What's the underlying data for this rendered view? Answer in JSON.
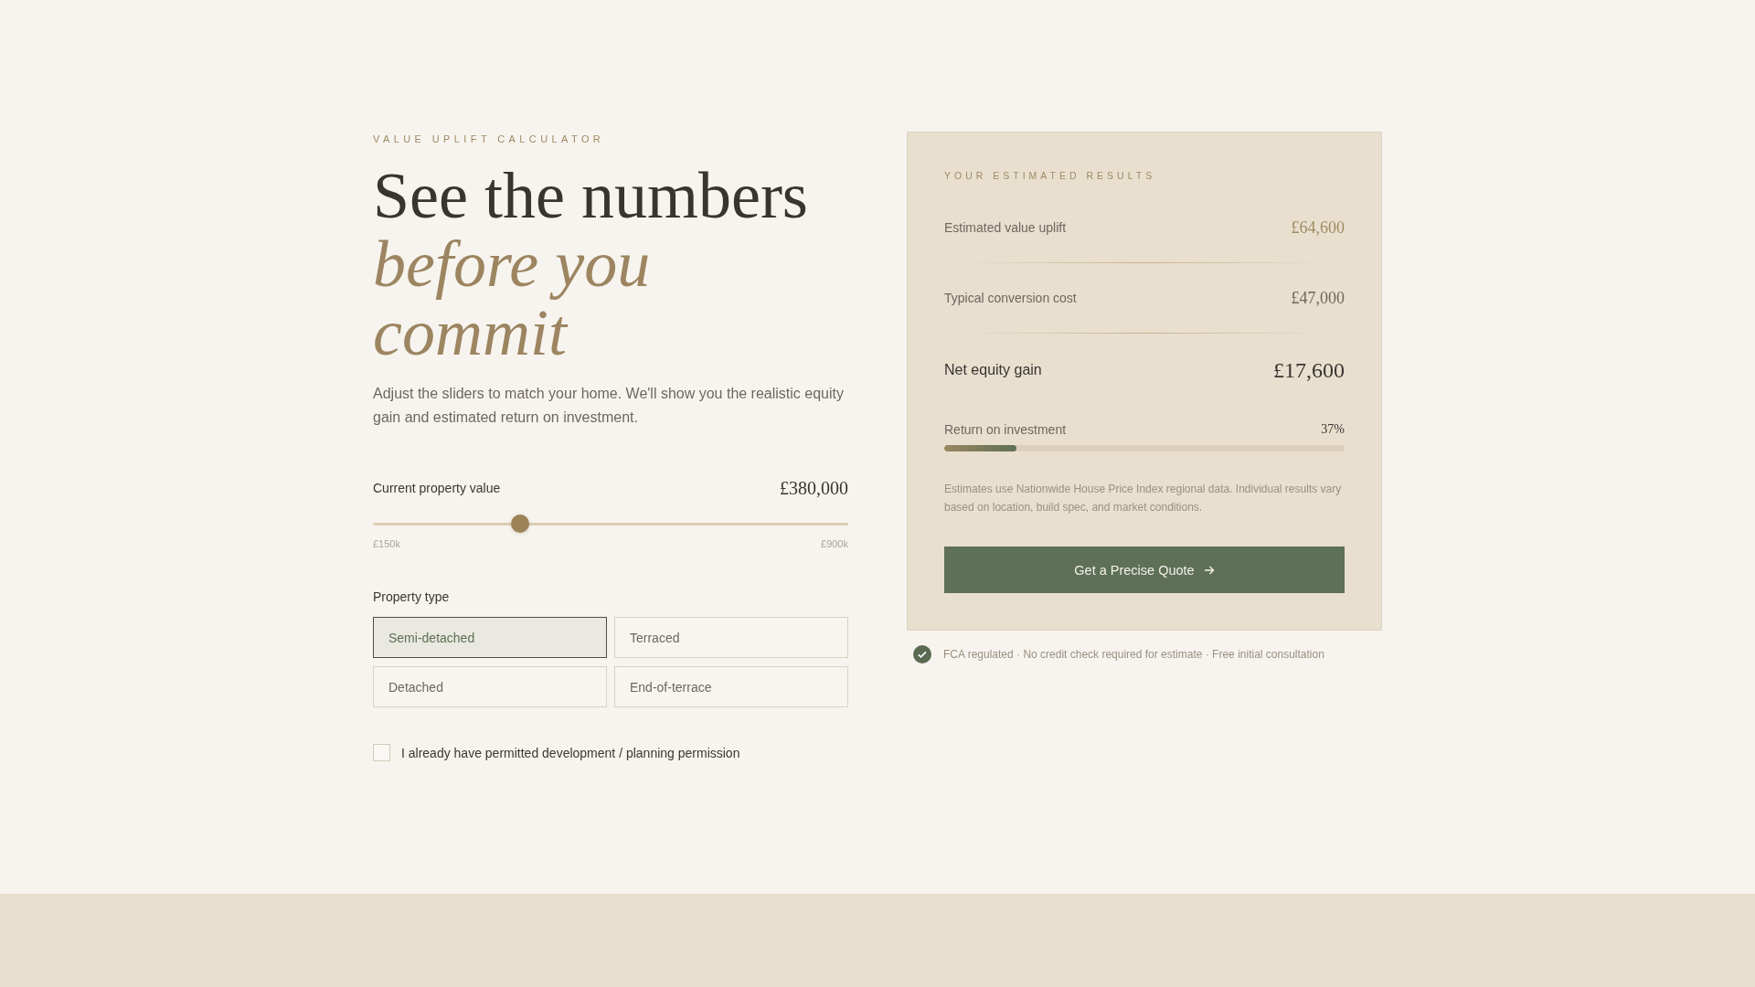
{
  "calculator": {
    "eyebrow": "VALUE UPLIFT CALCULATOR",
    "heading": "See the numbers *before you commit*",
    "intro": "Adjust the sliders to match your home. We'll show you the realistic equity gain and estimated return on investment.",
    "property_value": {
      "label": "Current property value",
      "value": "£380,000",
      "level": 0.31,
      "min_label": "£150k",
      "max_label": "£900k"
    },
    "property_type": {
      "label": "Property type",
      "options": [
        {
          "label": "Semi-detached",
          "selected": true
        },
        {
          "label": "Terraced",
          "selected": false
        },
        {
          "label": "Detached",
          "selected": false
        },
        {
          "label": "End-of-terrace",
          "selected": false
        }
      ]
    },
    "permission": {
      "label": "I already have permitted development / planning permission",
      "checked": false
    }
  },
  "results": {
    "eyebrow": "YOUR ESTIMATED RESULTS",
    "rows": [
      {
        "kind": "uplift",
        "label": "Estimated value uplift",
        "value": "£64,600"
      },
      {
        "kind": "cost",
        "label": "Typical conversion cost",
        "value": "£47,000"
      },
      {
        "kind": "net",
        "label": "Net equity gain",
        "value": "£17,600"
      }
    ],
    "roi": {
      "label": "Return on investment",
      "value": "37%",
      "level": 0.18
    },
    "disclaimer": "Estimates use Nationwide House Price Index regional data. Individual results vary based on location, build spec, and market conditions.",
    "button": "Get a Precise Quote"
  },
  "trust_note": "FCA regulated · No credit check required for estimate · Free initial consultation"
}
